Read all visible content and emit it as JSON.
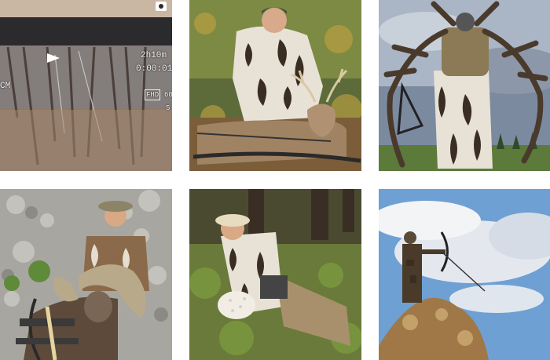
{
  "feed": {
    "posts": [
      {
        "subject": "trail-camera-forest-video"
      },
      {
        "subject": "hunter-with-whitetail-buck"
      },
      {
        "subject": "hunter-carrying-elk-antlers"
      },
      {
        "subject": "hunter-with-bighorn-ram"
      },
      {
        "subject": "hunter-with-puffball-mushroom"
      },
      {
        "subject": "archer-drawing-bow-on-rock"
      }
    ],
    "camera_overlay": {
      "time_remaining": "2h10m",
      "timecode": "0:00:01",
      "quality_badge": "FHD",
      "side_left": "CM",
      "fps_fragment": "60",
      "fps_fragment_2": "5"
    }
  },
  "colors": {
    "background": "#ffffff",
    "camouflage_dark": "#3a2d22",
    "camouflage_light": "#e8e2d6"
  }
}
